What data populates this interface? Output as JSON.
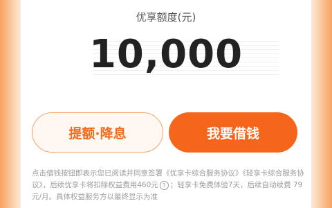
{
  "header": {
    "title": "优享额度(元)"
  },
  "credit": {
    "amount": "10,000"
  },
  "actions": {
    "secondary_label": "提额·降息",
    "primary_label": "我要借钱"
  },
  "notice": {
    "part1": "点击借钱按钮即表示您已阅读并同意签署",
    "link1": "《优享卡综合服务协议》",
    "link2": "《轻享卡综合服务协议》",
    "part2": "，后续优享卡将扣除权益费用460元",
    "help_icon": "?",
    "part3": "；轻享卡免费体验7天，后续自动续费 79元/月。具体权益服务方以最终显示为准"
  },
  "colors": {
    "accent": "#f5661c",
    "accent_light": "#f4a46a",
    "side_gradient": "#f7a35f"
  },
  "icons": {
    "help": "question-circle-icon"
  }
}
